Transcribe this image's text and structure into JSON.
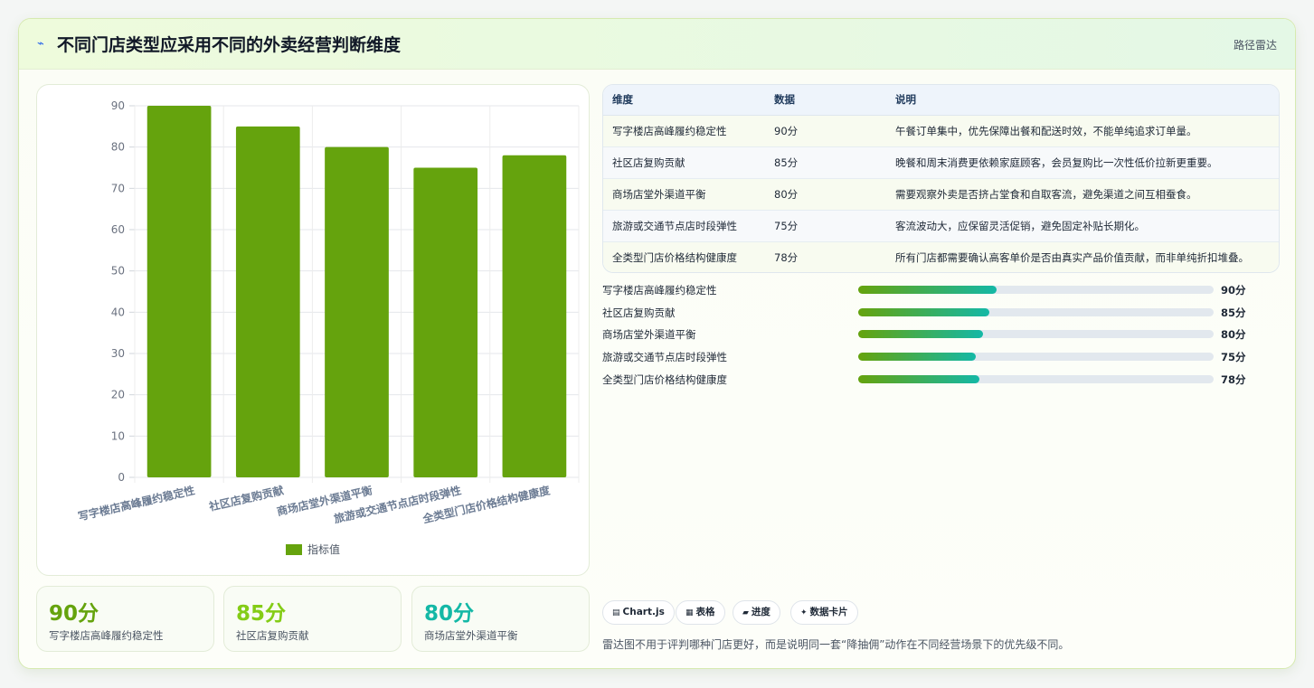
{
  "header": {
    "icon": "lightning-icon",
    "title": "不同门店类型应采用不同的外卖经营判断维度",
    "tag": "路径雷达"
  },
  "chart_data": {
    "type": "bar",
    "categories": [
      "写字楼店高峰履约稳定性",
      "社区店复购贡献",
      "商场店堂外渠道平衡",
      "旅游或交通节点店时段弹性",
      "全类型门店价格结构健康度"
    ],
    "series": [
      {
        "name": "指标值",
        "values": [
          90,
          85,
          80,
          75,
          78
        ]
      }
    ],
    "ylim": [
      0,
      90
    ],
    "yticks": [
      0,
      10,
      20,
      30,
      40,
      50,
      60,
      70,
      80,
      90
    ],
    "grid": true,
    "legend": "bottom",
    "color": "#65a30d"
  },
  "stats": [
    {
      "value": "90分",
      "label": "写字楼店高峰履约稳定性",
      "color": "#65a30d"
    },
    {
      "value": "85分",
      "label": "社区店复购贡献",
      "color": "#84cc16"
    },
    {
      "value": "80分",
      "label": "商场店堂外渠道平衡",
      "color": "#14b8a6"
    }
  ],
  "table": {
    "headers": [
      "维度",
      "数据",
      "说明"
    ],
    "rows": [
      [
        "写字楼店高峰履约稳定性",
        "90分",
        "午餐订单集中，优先保障出餐和配送时效，不能单纯追求订单量。"
      ],
      [
        "社区店复购贡献",
        "85分",
        "晚餐和周末消费更依赖家庭顾客，会员复购比一次性低价拉新更重要。"
      ],
      [
        "商场店堂外渠道平衡",
        "80分",
        "需要观察外卖是否挤占堂食和自取客流，避免渠道之间互相蚕食。"
      ],
      [
        "旅游或交通节点店时段弹性",
        "75分",
        "客流波动大，应保留灵活促销，避免固定补贴长期化。"
      ],
      [
        "全类型门店价格结构健康度",
        "78分",
        "所有门店都需要确认高客单价是否由真实产品价值贡献，而非单纯折扣堆叠。"
      ]
    ]
  },
  "progress": [
    {
      "name": "写字楼店高峰履约稳定性",
      "score": "90分",
      "percent": 39
    },
    {
      "name": "社区店复购贡献",
      "score": "85分",
      "percent": 37
    },
    {
      "name": "商场店堂外渠道平衡",
      "score": "80分",
      "percent": 35
    },
    {
      "name": "旅游或交通节点店时段弹性",
      "score": "75分",
      "percent": 33
    },
    {
      "name": "全类型门店价格结构健康度",
      "score": "78分",
      "percent": 34
    }
  ],
  "chips": [
    {
      "icon": "chart-icon",
      "glyph": "▤",
      "label": "Chart.js"
    },
    {
      "icon": "table-icon",
      "glyph": "▦",
      "label": "表格"
    },
    {
      "icon": "progress-icon",
      "glyph": "▰",
      "label": "进度"
    },
    {
      "icon": "sparkle-icon",
      "glyph": "✦",
      "label": "数据卡片"
    }
  ],
  "footnote": "雷达图不用于评判哪种门店更好，而是说明同一套“降抽佣”动作在不同经营场景下的优先级不同。"
}
